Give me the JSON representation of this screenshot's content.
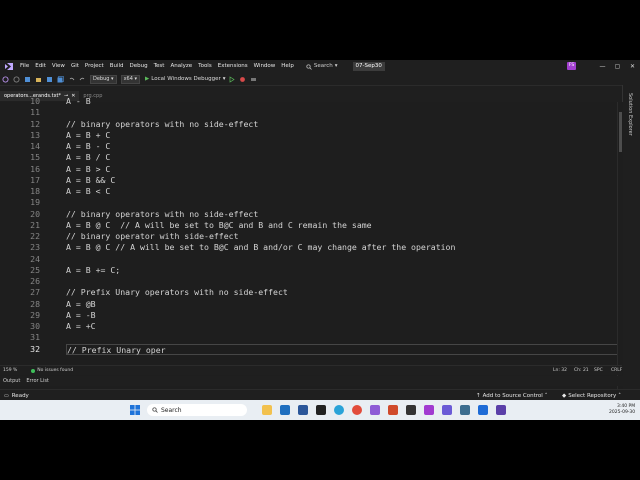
{
  "menubar": {
    "items": [
      "File",
      "Edit",
      "View",
      "Git",
      "Project",
      "Build",
      "Debug",
      "Test",
      "Analyze",
      "Tools",
      "Extensions",
      "Window",
      "Help"
    ],
    "search_label": "Search",
    "branch_label": "07-Sep30",
    "account_initials": "FS"
  },
  "toolbar": {
    "config_value": "Debug",
    "platform_value": "x64",
    "run_label": "Local Windows Debugger"
  },
  "tabs": [
    {
      "label": "operators...erands.txt*",
      "active": true
    },
    {
      "label": "prg.cpp",
      "active": false
    }
  ],
  "right_panel": {
    "label": "Solution Explorer"
  },
  "editor": {
    "lines": [
      {
        "num": "10",
        "text": "A - B"
      },
      {
        "num": "11",
        "text": ""
      },
      {
        "num": "12",
        "text": "// binary operators with no side-effect"
      },
      {
        "num": "13",
        "text": "A = B + C"
      },
      {
        "num": "14",
        "text": "A = B - C"
      },
      {
        "num": "15",
        "text": "A = B / C"
      },
      {
        "num": "16",
        "text": "A = B > C"
      },
      {
        "num": "17",
        "text": "A = B && C"
      },
      {
        "num": "18",
        "text": "A = B < C"
      },
      {
        "num": "19",
        "text": ""
      },
      {
        "num": "20",
        "text": "// binary operators with no side-effect"
      },
      {
        "num": "21",
        "text": "A = B @ C  // A will be set to B@C and B and C remain the same"
      },
      {
        "num": "22",
        "text": "// binary operator with side-effect"
      },
      {
        "num": "23",
        "text": "A = B @ C // A will be set to B@C and B and/or C may change after the operation"
      },
      {
        "num": "24",
        "text": ""
      },
      {
        "num": "25",
        "text": "A = B += C;"
      },
      {
        "num": "26",
        "text": ""
      },
      {
        "num": "27",
        "text": "// Prefix Unary operators with no side-effect"
      },
      {
        "num": "28",
        "text": "A = @B"
      },
      {
        "num": "29",
        "text": "A = -B"
      },
      {
        "num": "30",
        "text": "A = +C"
      },
      {
        "num": "31",
        "text": ""
      },
      {
        "num": "32",
        "text": "// Prefix Unary oper"
      }
    ],
    "current_line": "32"
  },
  "status_strip": {
    "zoom": "159 %",
    "issues": "No issues found",
    "line": "Ln: 32",
    "col": "Ch: 21",
    "spc": "SPC",
    "eol": "CRLF"
  },
  "output_tabs": [
    "Output",
    "Error List"
  ],
  "statusbar": {
    "ready": "Ready",
    "source_control": "Add to Source Control",
    "repository": "Select Repository"
  },
  "taskbar": {
    "search_label": "Search",
    "time": "3:40 PM",
    "date": "2025-09-30"
  }
}
